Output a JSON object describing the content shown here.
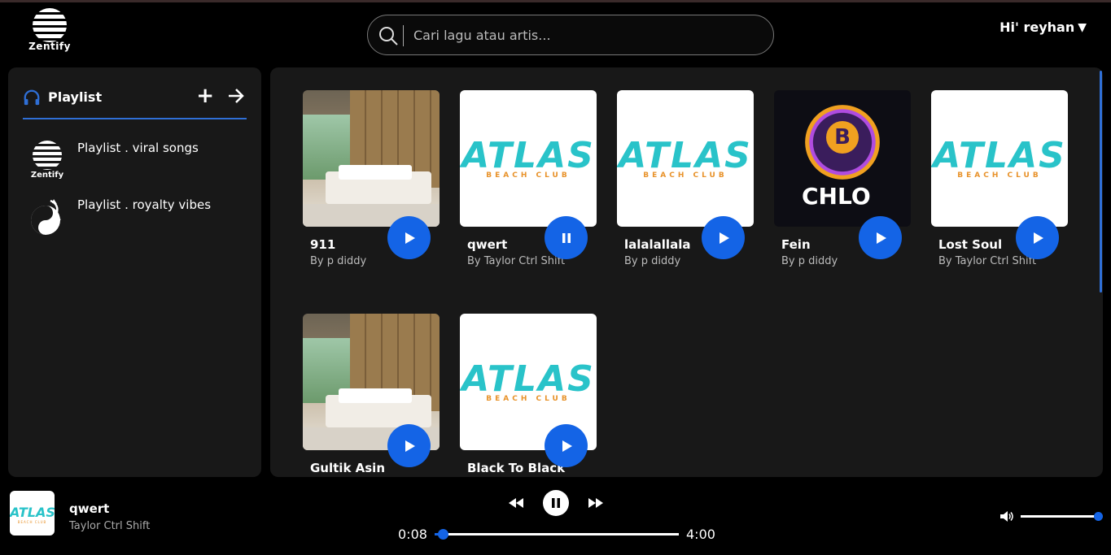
{
  "app": {
    "logo_text": "Zentify"
  },
  "search": {
    "placeholder": "Cari lagu atau artis..."
  },
  "user": {
    "greeting": "Hi' reyhan",
    "caret": "▼"
  },
  "sidebar": {
    "title": "Playlist",
    "add_icon": "+",
    "items": [
      {
        "label": "Playlist . viral songs",
        "thumb": "zentify-logo"
      },
      {
        "label": "Playlist . royalty vibes",
        "thumb": "dragon-yin-yang-logo"
      }
    ]
  },
  "songs": [
    {
      "title": "911",
      "artist": "By p diddy",
      "art": "hotel-room",
      "state": "play"
    },
    {
      "title": "qwert",
      "artist": "By Taylor Ctrl Shift",
      "art": "atlas-beach-club",
      "state": "pause"
    },
    {
      "title": "lalalallala",
      "artist": "By p diddy",
      "art": "atlas-beach-club",
      "state": "play"
    },
    {
      "title": "Fein",
      "artist": "By p diddy",
      "art": "chlo-tiger-bitcoin",
      "state": "play"
    },
    {
      "title": "Lost Soul",
      "artist": "By Taylor Ctrl Shift",
      "art": "atlas-beach-club",
      "state": "play"
    },
    {
      "title": "Gultik Asin",
      "artist": "",
      "art": "hotel-room",
      "state": "play"
    },
    {
      "title": "Black To Black",
      "artist": "",
      "art": "atlas-beach-club",
      "state": "play"
    }
  ],
  "art_text": {
    "atlas": "ATLAS",
    "beach": "BEACH CLUB",
    "chlo": "CHLO",
    "coin": "B"
  },
  "player": {
    "title": "qwert",
    "artist": "Taylor Ctrl Shift",
    "current_time": "0:08",
    "duration": "4:00",
    "progress": 0.033,
    "volume": 1.0
  },
  "colors": {
    "accent": "#1464e6",
    "panel": "#181818",
    "atlas_teal": "#29c3c9",
    "atlas_orange": "#e8922a"
  }
}
